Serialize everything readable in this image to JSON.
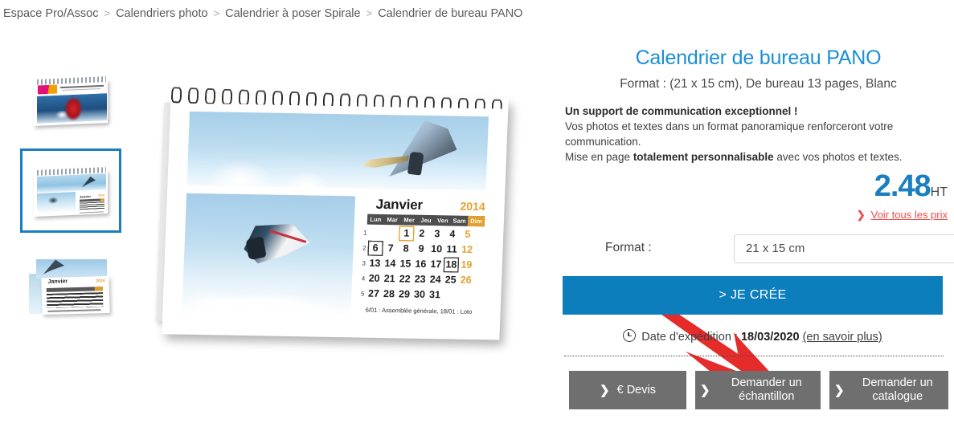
{
  "breadcrumb": {
    "separator": ">",
    "items": [
      {
        "label": "Espace Pro/Assoc"
      },
      {
        "label": "Calendriers photo"
      },
      {
        "label": "Calendrier à poser Spirale"
      },
      {
        "label": "Calendrier de bureau PANO"
      }
    ]
  },
  "gallery": {
    "thumbnails": [
      {
        "name": "thumb-cover-logo",
        "alt": "Couverture calendrier planche à voile avec logo",
        "selected": false
      },
      {
        "name": "thumb-open-pano",
        "alt": "Calendrier de bureau PANO ouvert",
        "selected": true
      },
      {
        "name": "thumb-calendar-closeup",
        "alt": "Gros plan page calendrier Janvier",
        "selected": false
      }
    ],
    "watermark": "",
    "main_alt": "Calendrier de bureau PANO spirale ouvert"
  },
  "calendar_preview": {
    "month": "Janvier",
    "year": "2014",
    "weekday_headers": [
      "Lun",
      "Mar",
      "Mer",
      "Jeu",
      "Ven",
      "Sam",
      "Dim"
    ],
    "week_numbers": [
      "1",
      "2",
      "3",
      "4",
      "5"
    ],
    "weeks": [
      [
        "",
        "",
        "1",
        "2",
        "3",
        "4",
        "5"
      ],
      [
        "6",
        "7",
        "8",
        "9",
        "10",
        "11",
        "12"
      ],
      [
        "13",
        "14",
        "15",
        "16",
        "17",
        "18",
        "19"
      ],
      [
        "20",
        "21",
        "22",
        "23",
        "24",
        "25",
        "26"
      ],
      [
        "27",
        "28",
        "29",
        "30",
        "31",
        "",
        ""
      ]
    ],
    "highlighted_orange": [
      "1"
    ],
    "highlighted_box": [
      "6",
      "18"
    ],
    "note": "6/01 : Assemblée générale, 18/01 : Loto",
    "colors": {
      "sunday": "#e2a12e",
      "header_bar": "#4e4e4e"
    }
  },
  "product": {
    "title": "Calendrier de bureau PANO",
    "subtitle": "Format : (21 x 15 cm), De bureau 13 pages, Blanc",
    "description": {
      "headline": "Un support de communication exceptionnel !",
      "line2": "Vos photos et textes dans un format panoramique renforceront votre communication.",
      "line3_prefix": "Mise en page ",
      "line3_bold": "totalement personnalisable",
      "line3_suffix": " avec vos photos et textes."
    },
    "price": {
      "amount": "2.48",
      "tax_label": "HT"
    },
    "all_prices_link": "Voir tous les prix",
    "all_prices_chevron": "❯"
  },
  "options": {
    "format_label": "Format :",
    "format_selected": "21 x 15 cm",
    "format_options": [
      "21 x 15 cm"
    ]
  },
  "cta": {
    "create_label": "> JE CRÉE"
  },
  "shipping": {
    "icon": "clock-icon",
    "label": "Date d'expédition :",
    "date": "18/03/2020",
    "more_link": "(en savoir plus)"
  },
  "secondary_buttons": [
    {
      "name": "quote-button",
      "chevron": "❯",
      "label": "€ Devis"
    },
    {
      "name": "sample-button",
      "chevron": "❯",
      "label": "Demander un échantillon"
    },
    {
      "name": "catalogue-button",
      "chevron": "❯",
      "label": "Demander un catalogue"
    }
  ],
  "colors": {
    "brand_blue": "#1a8fd4",
    "cta_blue": "#0b7ebb",
    "price_blue": "#1a7fc1",
    "link_red": "#ef4b4b",
    "accent_orange": "#e2a12e",
    "gray_button": "#6f6f6f",
    "arrow_red": "#e62b2b"
  }
}
